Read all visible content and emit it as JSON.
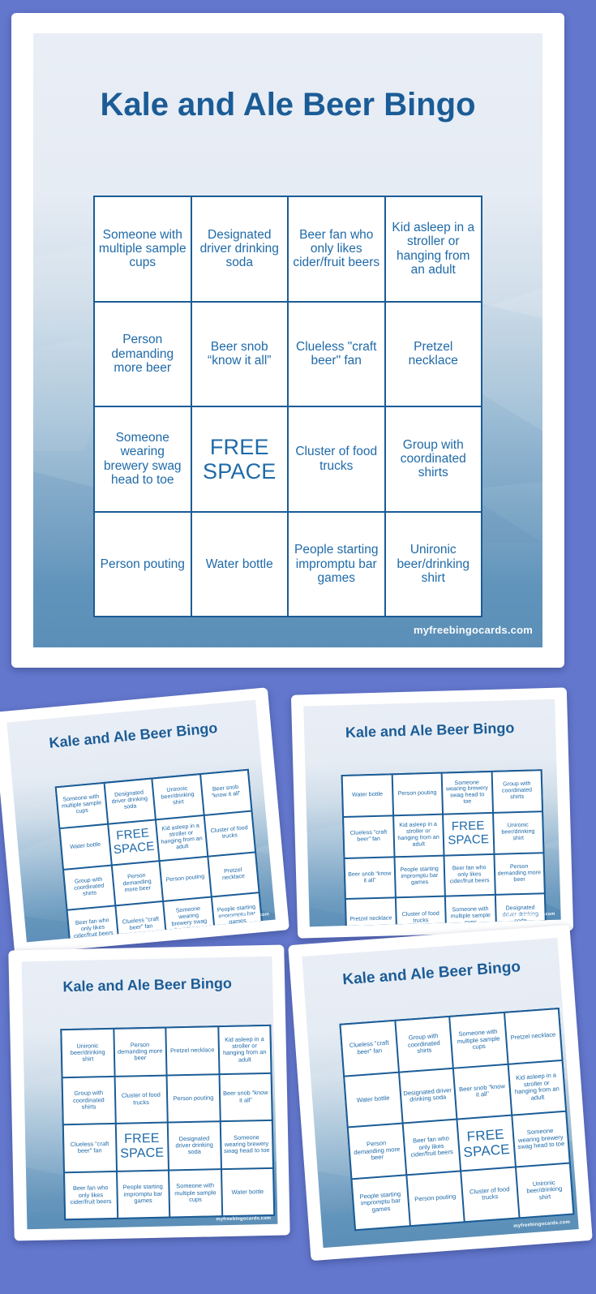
{
  "page": {
    "background_color": "#6377cd",
    "title_color": "#1b5c96",
    "cell_text_color": "#1f6aa8",
    "grid_border_color": "#1b5c96",
    "card_top_color": "#e9eef6",
    "card_bottom_color": "#5b8fb7"
  },
  "common": {
    "title": "Kale and Ale Beer Bingo",
    "watermark": "myfreebingocards.com",
    "free_space": "FREE SPACE"
  },
  "squares": {
    "multiple_cups": "Someone with multiple sample cups",
    "designated_driver": "Designated driver drinking soda",
    "cider_fan": "Beer fan who only likes cider/fruit beers",
    "kid_asleep": "Kid asleep in a stroller or hanging from an adult",
    "demanding_more": "Person demanding more beer",
    "beer_snob": "Beer snob “know it all”",
    "clueless_fan": "Clueless \"craft beer\" fan",
    "pretzel": "Pretzel necklace",
    "brewery_swag": "Someone wearing brewery swag head to toe",
    "free": "FREE SPACE",
    "food_trucks": "Cluster of food trucks",
    "coordinated_shirts": "Group with coordinated shirts",
    "pouting": "Person pouting",
    "water_bottle": "Water bottle",
    "bar_games": "People starting impromptu bar games",
    "unironic_shirt": "Unironic beer/drinking shirt"
  },
  "cards": [
    {
      "id": "card-main",
      "title": "Kale and Ale Beer Bingo",
      "watermark": "myfreebingocards.com",
      "cells": [
        "Someone with multiple sample cups",
        "Designated driver drinking soda",
        "Beer fan who only likes cider/fruit beers",
        "Kid asleep in a stroller or hanging from an adult",
        "Person demanding more beer",
        "Beer snob “know it all”",
        "Clueless \"craft beer\" fan",
        "Pretzel necklace",
        "Someone wearing brewery swag head to toe",
        "FREE SPACE",
        "Cluster of food trucks",
        "Group with coordinated shirts",
        "Person pouting",
        "Water bottle",
        "People starting impromptu bar games",
        "Unironic beer/drinking shirt"
      ]
    },
    {
      "id": "card-2",
      "title": "Kale and Ale Beer Bingo",
      "watermark": "myfreebingocards.com",
      "cells": [
        "Someone with multiple sample cups",
        "Designated driver drinking soda",
        "Unironic beer/drinking shirt",
        "Beer snob “know it all”",
        "Water bottle",
        "FREE SPACE",
        "Kid asleep in a stroller or hanging from an adult",
        "Cluster of food trucks",
        "Group with coordinated shirts",
        "Person demanding more beer",
        "Person pouting",
        "Pretzel necklace",
        "Beer fan who only likes cider/fruit beers",
        "Clueless \"craft beer\" fan",
        "Someone wearing brewery swag head to toe",
        "People starting impromptu bar games"
      ]
    },
    {
      "id": "card-3",
      "title": "Kale and Ale Beer Bingo",
      "watermark": "myfreebingocards.com",
      "cells": [
        "Water bottle",
        "Person pouting",
        "Someone wearing brewery swag head to toe",
        "Group with coordinated shirts",
        "Clueless \"craft beer\" fan",
        "Kid asleep in a stroller or hanging from an adult",
        "FREE SPACE",
        "Unironic beer/drinking shirt",
        "Beer snob “know it all”",
        "People starting impromptu bar games",
        "Beer fan who only likes cider/fruit beers",
        "Person demanding more beer",
        "Pretzel necklace",
        "Cluster of food trucks",
        "Someone with multiple sample cups",
        "Designated driver drinking soda"
      ]
    },
    {
      "id": "card-4",
      "title": "Kale and Ale Beer Bingo",
      "watermark": "myfreebingocards.com",
      "cells": [
        "Unironic beer/drinking shirt",
        "Person demanding more beer",
        "Pretzel necklace",
        "Kid asleep in a stroller or hanging from an adult",
        "Group with coordinated shirts",
        "Cluster of food trucks",
        "Person pouting",
        "Beer snob “know it all”",
        "Clueless \"craft beer\" fan",
        "FREE SPACE",
        "Designated driver drinking soda",
        "Someone wearing brewery swag head to toe",
        "Beer fan who only likes cider/fruit beers",
        "People starting impromptu bar games",
        "Someone with multiple sample cups",
        "Water bottle"
      ]
    },
    {
      "id": "card-5",
      "title": "Kale and Ale Beer Bingo",
      "watermark": "myfreebingocards.com",
      "cells": [
        "Clueless \"craft beer\" fan",
        "Group with coordinated shirts",
        "Someone with multiple sample cups",
        "Pretzel necklace",
        "Water bottle",
        "Designated driver drinking soda",
        "Beer snob “know it all”",
        "Kid asleep in a stroller or hanging from an adult",
        "Person demanding more beer",
        "Beer fan who only likes cider/fruit beers",
        "FREE SPACE",
        "Someone wearing brewery swag head to toe",
        "People starting impromptu bar games",
        "Person pouting",
        "Cluster of food trucks",
        "Unironic beer/drinking shirt"
      ]
    }
  ]
}
